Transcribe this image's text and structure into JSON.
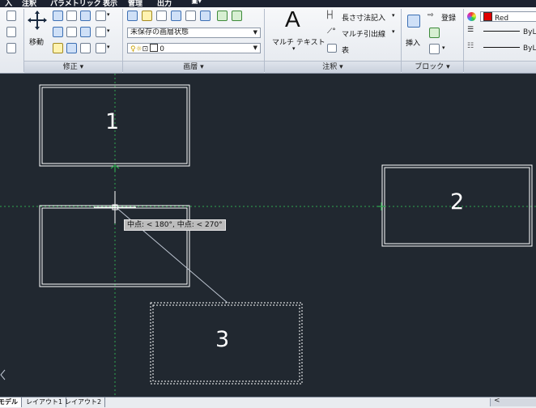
{
  "menubar": {
    "items": [
      "入",
      "注釈",
      "パラメトリック",
      "表示",
      "管理",
      "出力"
    ]
  },
  "ribbon": {
    "modify": {
      "move_label": "移動",
      "panel_title": "修正 ▾"
    },
    "layers": {
      "layer_state": "未保存の画層状態",
      "current_layer": "0",
      "panel_title": "画層 ▾"
    },
    "annotation": {
      "multiline_text": "マルチ テキスト",
      "dimension": "長さ寸法記入",
      "multileader": "マルチ引出線",
      "table": "表",
      "panel_title": "注釈 ▾"
    },
    "block": {
      "insert": "挿入",
      "register": "登録",
      "panel_title": "ブロック ▾"
    },
    "properties": {
      "color": "Red",
      "linetype": "ByL",
      "lineweight": "ByL",
      "color_hex": "#e00000"
    }
  },
  "canvas": {
    "rect_labels": [
      "1",
      "2",
      "3"
    ],
    "tooltip": "中点: < 180°,  中点: < 270°"
  },
  "tabs": {
    "model": "モデル",
    "layout1": "レイアウト1",
    "layout2": "レイアウト2"
  },
  "scroll": {
    "left_arrow": "<"
  },
  "colors": {
    "canvas_bg": "#212830",
    "tracking_line": "#2fa84f",
    "rect_stroke": "#ffffff"
  }
}
